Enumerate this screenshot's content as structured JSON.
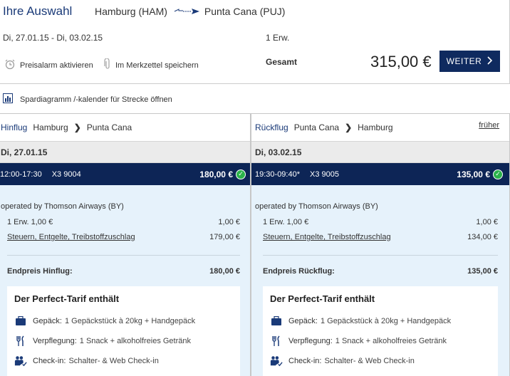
{
  "header": {
    "title": "Ihre Auswahl",
    "origin": "Hamburg (HAM)",
    "destination": "Punta Cana (PUJ)",
    "dates": "Di, 27.01.15 - Di, 03.02.15",
    "passengers": "1 Erw.",
    "preisalarm": "Preisalarm aktivieren",
    "merkzettel": "Im Merkzettel speichern",
    "total_label": "Gesamt",
    "total_price": "315,00 €",
    "weiter": "WEITER"
  },
  "spar": {
    "label": "Spardiagramm /-kalender für Strecke öffnen"
  },
  "outbound": {
    "label": "Hinflug",
    "from": "Hamburg",
    "to": "Punta Cana",
    "date": "Di, 27.01.15",
    "time": "12:00-17:30",
    "flight_no": "X3 9004",
    "price": "180,00 €",
    "operated": "operated by Thomson Airways (BY)",
    "fare_label": "1 Erw. 1,00 €",
    "fare_value": "1,00 €",
    "taxes_label": "Steuern, Entgelte, Treibstoffzuschlag",
    "taxes_value": "179,00 €",
    "endpreis_label": "Endpreis Hinflug:",
    "endpreis_value": "180,00 €",
    "tarif_title": "Der Perfect-Tarif enthält",
    "gepaeck_label": "Gepäck:",
    "gepaeck_value": "1 Gepäckstück à 20kg + Handgepäck",
    "verpflegung_label": "Verpflegung:",
    "verpflegung_value": "1 Snack + alkoholfreies Getränk",
    "checkin_label": "Check-in:",
    "checkin_value": "Schalter- & Web Check-in"
  },
  "return": {
    "label": "Rückflug",
    "from": "Punta Cana",
    "to": "Hamburg",
    "earlier": "früher",
    "date": "Di, 03.02.15",
    "time": "19:30-09:40*",
    "flight_no": "X3 9005",
    "price": "135,00 €",
    "operated": "operated by Thomson Airways (BY)",
    "fare_label": "1 Erw. 1,00 €",
    "fare_value": "1,00 €",
    "taxes_label": "Steuern, Entgelte, Treibstoffzuschlag",
    "taxes_value": "134,00 €",
    "endpreis_label": "Endpreis Rückflug:",
    "endpreis_value": "135,00 €",
    "tarif_title": "Der Perfect-Tarif enthält",
    "gepaeck_label": "Gepäck:",
    "gepaeck_value": "1 Gepäckstück à 20kg + Handgepäck",
    "verpflegung_label": "Verpflegung:",
    "verpflegung_value": "1 Snack + alkoholfreies Getränk",
    "checkin_label": "Check-in:",
    "checkin_value": "Schalter- & Web Check-in"
  },
  "colors": {
    "brand_navy": "#0d2556",
    "title_blue": "#1a3a78",
    "detail_bg": "#e6f2fb",
    "check_green": "#2bb24a"
  },
  "icons": [
    "plane-route-icon",
    "alarm-clock-icon",
    "paperclip-icon",
    "chevron-right-icon",
    "bar-chart-icon",
    "check-circle-icon",
    "suitcase-icon",
    "cutlery-icon",
    "passengers-icon"
  ]
}
